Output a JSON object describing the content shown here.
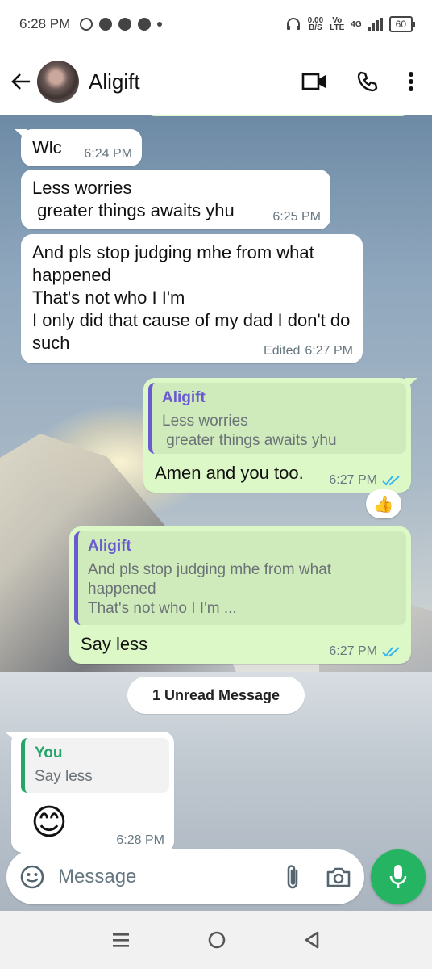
{
  "status_bar": {
    "time": "6:28 PM",
    "net_speed": "0.00",
    "net_unit": "B/S",
    "volte": "Vo",
    "lte": "LTE",
    "network": "4G",
    "battery": "60"
  },
  "header": {
    "contact_name": "Aligift",
    "icons": [
      "back-arrow-icon",
      "video-call-icon",
      "voice-call-icon",
      "more-options-icon"
    ]
  },
  "messages": [
    {
      "direction": "in",
      "text": "Wlc",
      "time": "6:24 PM"
    },
    {
      "direction": "in",
      "text": "Less worries\n greater things awaits yhu",
      "time": "6:25 PM"
    },
    {
      "direction": "in",
      "text": "And pls stop judging mhe from what happened\nThat's not who I I'm\nI only did that cause of my dad I don't do such",
      "edited": "Edited",
      "time": "6:27 PM"
    },
    {
      "direction": "out",
      "quote_name": "Aligift",
      "quote_text": "Less worries\n greater things awaits yhu",
      "text": "Amen and you too.",
      "time": "6:27 PM",
      "reaction": "👍"
    },
    {
      "direction": "out",
      "quote_name": "Aligift",
      "quote_text": "And pls stop judging mhe from what happened\nThat's not who I I'm ...",
      "text": "Say less",
      "time": "6:27 PM"
    },
    {
      "direction": "in",
      "quote_name": "You",
      "quote_text": "Say less",
      "text": "😊",
      "time": "6:28 PM"
    }
  ],
  "unread_label": "1 Unread Message",
  "composer": {
    "placeholder": "Message"
  },
  "colors": {
    "outgoing_bubble": "#dcf8c6",
    "incoming_bubble": "#ffffff",
    "accent_green": "#25b562",
    "quote_purple": "#6a5ad1",
    "quote_green": "#25a56a",
    "read_ticks": "#34b7f1"
  }
}
